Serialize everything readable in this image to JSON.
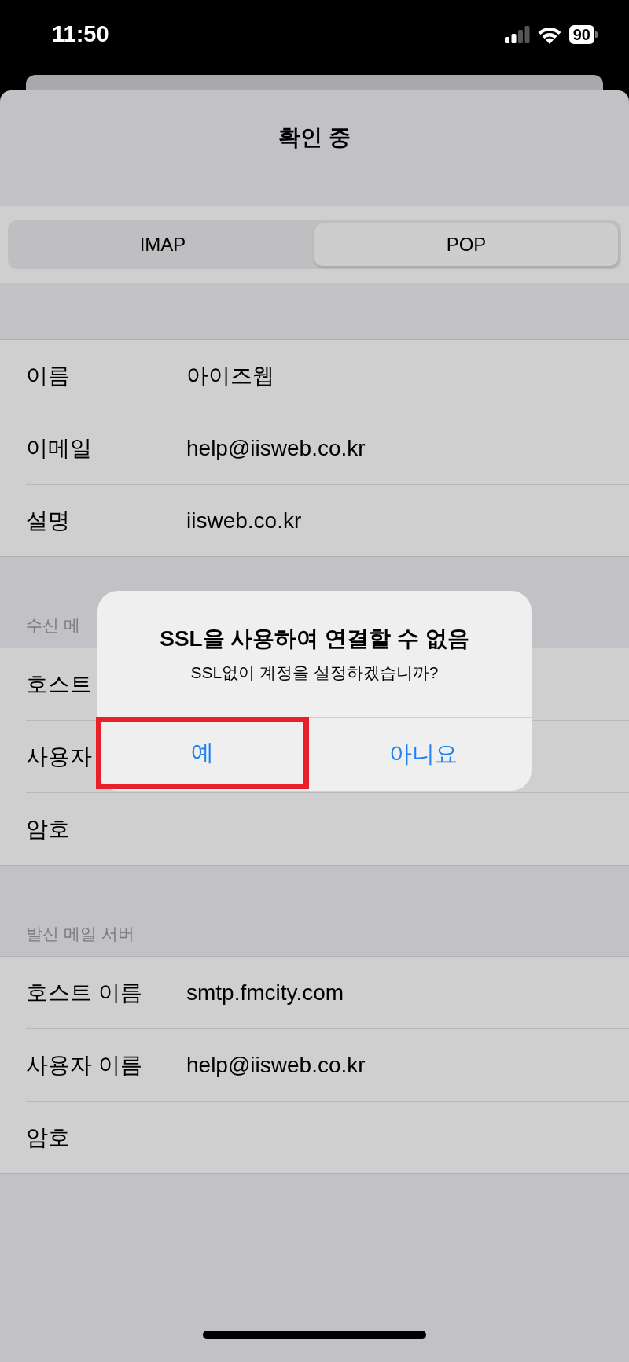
{
  "status_bar": {
    "time": "11:50",
    "battery": "90"
  },
  "title": "확인 중",
  "segments": [
    {
      "label": "IMAP",
      "selected": false
    },
    {
      "label": "POP",
      "selected": true
    }
  ],
  "sections": [
    {
      "rows": [
        {
          "label": "이름",
          "value": "아이즈웹"
        },
        {
          "label": "이메일",
          "value": "help@iisweb.co.kr"
        },
        {
          "label": "설명",
          "value": "iisweb.co.kr"
        }
      ]
    },
    {
      "header": "수신 메",
      "rows": [
        {
          "label": "호스트"
        },
        {
          "label": "사용자"
        },
        {
          "label": "암호"
        }
      ]
    },
    {
      "header": "발신 메일 서버",
      "rows": [
        {
          "label": "호스트 이름",
          "value": "smtp.fmcity.com"
        },
        {
          "label": "사용자 이름",
          "value": "help@iisweb.co.kr"
        },
        {
          "label": "암호"
        }
      ]
    }
  ],
  "alert": {
    "title": "SSL을 사용하여 연결할 수 없음",
    "message": "SSL없이 계정을 설정하겠습니까?",
    "buttons": [
      {
        "label": "예",
        "highlighted": true
      },
      {
        "label": "아니요",
        "highlighted": false
      }
    ]
  }
}
